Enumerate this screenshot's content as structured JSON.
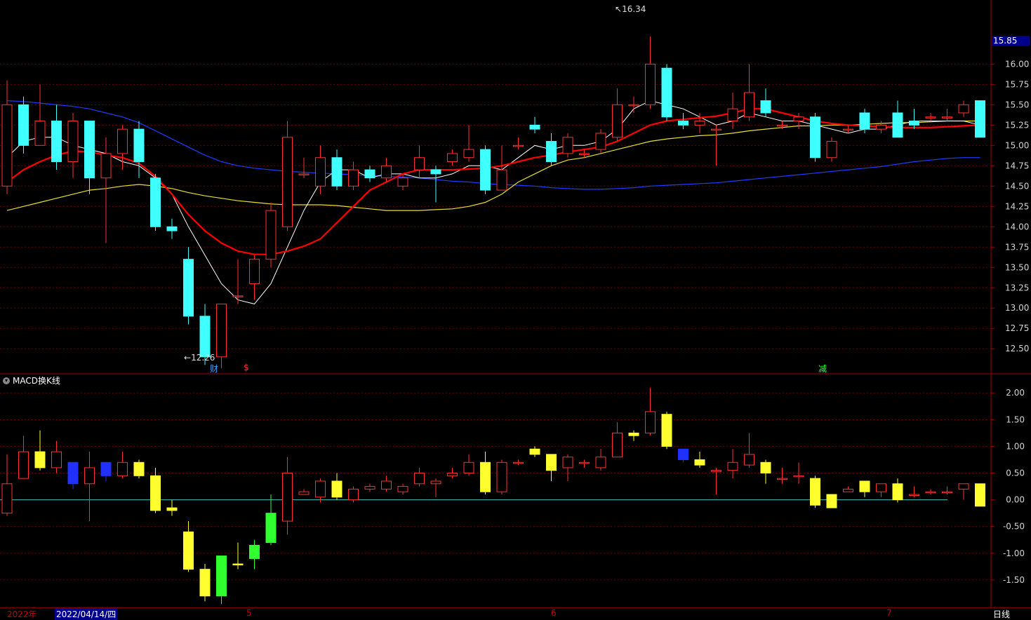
{
  "price_axis_labels": [
    "16.00",
    "15.75",
    "15.50",
    "15.25",
    "15.00",
    "14.75",
    "14.50",
    "14.25",
    "14.00",
    "13.75",
    "13.50",
    "13.25",
    "13.00",
    "12.75",
    "12.50"
  ],
  "macd_axis_labels": [
    "2.00",
    "1.50",
    "1.00",
    "0.50",
    "0.00",
    "-0.50",
    "-1.00",
    "-1.50"
  ],
  "current_price": "15.85",
  "high_label": "16.34",
  "low_label": "12.26",
  "indicator_title": "MACD换K线",
  "markers": {
    "cai": "财",
    "dollar": "$",
    "jian": "减"
  },
  "bottom": {
    "year": "2022年",
    "date": "2022/04/14/四",
    "m5": "5",
    "m6": "6",
    "m7": "7",
    "period": "日线"
  },
  "colors": {
    "up": "#ff3030",
    "down": "#40ffff",
    "ma5": "#ffffff",
    "ma10": "#ff0000",
    "ma20": "#e8e030",
    "ma60": "#1e3cff"
  },
  "chart_data": [
    {
      "type": "candlestick",
      "ylim": [
        12.2,
        16.4
      ],
      "candles": [
        [
          14.5,
          15.5,
          15.8,
          14.4
        ],
        [
          15.5,
          15.0,
          15.6,
          14.9
        ],
        [
          15.0,
          15.3,
          15.75,
          15.0
        ],
        [
          15.3,
          14.8,
          15.5,
          14.7
        ],
        [
          14.8,
          15.3,
          15.4,
          14.6
        ],
        [
          15.3,
          14.6,
          15.3,
          14.4
        ],
        [
          14.6,
          14.9,
          15.1,
          13.8
        ],
        [
          14.9,
          15.2,
          15.25,
          14.7
        ],
        [
          15.2,
          14.8,
          15.3,
          14.6
        ],
        [
          14.6,
          14.0,
          14.65,
          13.95
        ],
        [
          14.0,
          13.95,
          14.1,
          13.85
        ],
        [
          13.6,
          12.9,
          13.75,
          12.8
        ],
        [
          12.9,
          12.4,
          13.05,
          12.3
        ],
        [
          12.4,
          13.05,
          13.05,
          12.26
        ],
        [
          13.15,
          13.15,
          13.6,
          13.05
        ],
        [
          13.3,
          13.6,
          13.65,
          13.1
        ],
        [
          13.6,
          14.2,
          14.3,
          13.5
        ],
        [
          14.0,
          15.1,
          15.3,
          13.95
        ],
        [
          14.65,
          14.65,
          14.85,
          14.6
        ],
        [
          14.5,
          14.85,
          15.0,
          14.4
        ],
        [
          14.85,
          14.5,
          14.95,
          14.45
        ],
        [
          14.5,
          14.7,
          14.8,
          14.45
        ],
        [
          14.7,
          14.6,
          14.75,
          14.55
        ],
        [
          14.6,
          14.75,
          14.85,
          14.55
        ],
        [
          14.5,
          14.6,
          14.65,
          14.45
        ],
        [
          14.7,
          14.85,
          15.0,
          14.6
        ],
        [
          14.7,
          14.65,
          14.75,
          14.3
        ],
        [
          14.8,
          14.9,
          14.95,
          14.75
        ],
        [
          14.85,
          14.95,
          15.25,
          14.8
        ],
        [
          14.95,
          14.45,
          15.0,
          14.4
        ],
        [
          14.45,
          14.7,
          15.0,
          14.45
        ],
        [
          15.0,
          15.0,
          15.1,
          14.95
        ],
        [
          15.25,
          15.2,
          15.35,
          15.15
        ],
        [
          15.05,
          14.8,
          15.15,
          14.75
        ],
        [
          14.9,
          15.1,
          15.15,
          14.85
        ],
        [
          14.9,
          14.9,
          14.95,
          14.85
        ],
        [
          14.95,
          15.15,
          15.2,
          14.9
        ],
        [
          15.1,
          15.5,
          15.7,
          15.05
        ],
        [
          15.5,
          15.5,
          15.6,
          15.4
        ],
        [
          15.5,
          16.0,
          16.34,
          15.45
        ],
        [
          15.95,
          15.35,
          16.0,
          15.3
        ],
        [
          15.3,
          15.25,
          15.4,
          15.2
        ],
        [
          15.25,
          15.3,
          15.4,
          15.15
        ],
        [
          15.2,
          15.2,
          15.25,
          14.75
        ],
        [
          15.3,
          15.45,
          15.65,
          15.2
        ],
        [
          15.35,
          15.65,
          16.0,
          15.3
        ],
        [
          15.55,
          15.4,
          15.7,
          15.35
        ],
        [
          15.25,
          15.25,
          15.3,
          15.2
        ],
        [
          15.3,
          15.35,
          15.4,
          15.2
        ],
        [
          15.35,
          14.85,
          15.4,
          14.8
        ],
        [
          14.85,
          15.05,
          15.1,
          14.8
        ],
        [
          15.2,
          15.2,
          15.25,
          15.15
        ],
        [
          15.4,
          15.2,
          15.45,
          15.15
        ],
        [
          15.2,
          15.25,
          15.3,
          15.15
        ],
        [
          15.4,
          15.1,
          15.55,
          15.1
        ],
        [
          15.3,
          15.25,
          15.45,
          15.2
        ],
        [
          15.35,
          15.35,
          15.4,
          15.3
        ],
        [
          15.35,
          15.35,
          15.45,
          15.3
        ],
        [
          15.4,
          15.5,
          15.55,
          15.35
        ],
        [
          15.55,
          15.1,
          15.55,
          15.1
        ]
      ],
      "ma5": [
        14.85,
        15.05,
        15.1,
        15.1,
        15.0,
        14.95,
        14.9,
        14.8,
        14.75,
        14.6,
        14.4,
        14.0,
        13.65,
        13.3,
        13.1,
        13.05,
        13.3,
        13.75,
        14.2,
        14.55,
        14.7,
        14.7,
        14.6,
        14.65,
        14.65,
        14.6,
        14.6,
        14.65,
        14.75,
        14.75,
        14.7,
        14.85,
        15.0,
        14.95,
        15.0,
        15.0,
        15.05,
        15.2,
        15.45,
        15.55,
        15.5,
        15.45,
        15.35,
        15.25,
        15.3,
        15.4,
        15.35,
        15.3,
        15.3,
        15.25,
        15.2,
        15.15,
        15.2,
        15.2,
        15.25,
        15.3,
        15.3,
        15.3,
        15.3,
        15.25
      ],
      "ma10": [
        14.55,
        14.7,
        14.8,
        14.88,
        14.93,
        14.92,
        14.88,
        14.85,
        14.78,
        14.62,
        14.4,
        14.15,
        13.95,
        13.8,
        13.7,
        13.66,
        13.66,
        13.7,
        13.76,
        13.85,
        14.05,
        14.25,
        14.45,
        14.55,
        14.65,
        14.7,
        14.7,
        14.7,
        14.71,
        14.72,
        14.75,
        14.8,
        14.85,
        14.88,
        14.92,
        14.95,
        14.98,
        15.05,
        15.15,
        15.25,
        15.3,
        15.32,
        15.34,
        15.36,
        15.4,
        15.45,
        15.45,
        15.4,
        15.35,
        15.3,
        15.27,
        15.25,
        15.24,
        15.23,
        15.22,
        15.22,
        15.22,
        15.23,
        15.24,
        15.25
      ],
      "ma20": [
        14.2,
        14.25,
        14.3,
        14.35,
        14.4,
        14.45,
        14.47,
        14.5,
        14.52,
        14.5,
        14.47,
        14.42,
        14.38,
        14.35,
        14.32,
        14.3,
        14.28,
        14.27,
        14.27,
        14.27,
        14.26,
        14.24,
        14.22,
        14.2,
        14.2,
        14.2,
        14.21,
        14.22,
        14.25,
        14.3,
        14.4,
        14.55,
        14.65,
        14.75,
        14.82,
        14.85,
        14.9,
        14.95,
        15.0,
        15.05,
        15.08,
        15.1,
        15.12,
        15.13,
        15.15,
        15.18,
        15.2,
        15.22,
        15.24,
        15.24,
        15.25,
        15.25,
        15.26,
        15.27,
        15.28,
        15.28,
        15.29,
        15.3,
        15.3,
        15.3
      ],
      "ma60": [
        15.55,
        15.54,
        15.52,
        15.5,
        15.48,
        15.45,
        15.4,
        15.35,
        15.28,
        15.18,
        15.08,
        14.98,
        14.88,
        14.8,
        14.75,
        14.72,
        14.7,
        14.68,
        14.67,
        14.66,
        14.65,
        14.64,
        14.63,
        14.62,
        14.61,
        14.6,
        14.58,
        14.56,
        14.55,
        14.53,
        14.52,
        14.51,
        14.5,
        14.48,
        14.47,
        14.46,
        14.46,
        14.47,
        14.48,
        14.5,
        14.51,
        14.52,
        14.53,
        14.54,
        14.56,
        14.58,
        14.6,
        14.62,
        14.64,
        14.66,
        14.68,
        14.7,
        14.72,
        14.74,
        14.77,
        14.8,
        14.82,
        14.84,
        14.85,
        14.85
      ]
    },
    {
      "type": "candlestick",
      "ylim": [
        -2.0,
        2.2
      ],
      "candles": [
        [
          -0.25,
          0.3,
          0.85,
          -0.3
        ],
        [
          0.4,
          0.9,
          1.2,
          0.4
        ],
        [
          0.9,
          0.6,
          1.3,
          0.55
        ],
        [
          0.6,
          0.9,
          1.1,
          0.5
        ],
        [
          0.7,
          0.3,
          0.7,
          0.2
        ],
        [
          0.3,
          0.6,
          0.9,
          -0.4
        ],
        [
          0.7,
          0.45,
          0.7,
          0.35
        ],
        [
          0.45,
          0.7,
          0.9,
          0.4
        ],
        [
          0.7,
          0.45,
          0.75,
          0.4
        ],
        [
          0.45,
          -0.2,
          0.6,
          -0.25
        ],
        [
          -0.15,
          -0.2,
          0.0,
          -0.3
        ],
        [
          -0.6,
          -1.3,
          -0.4,
          -1.35
        ],
        [
          -1.3,
          -1.8,
          -1.2,
          -1.9
        ],
        [
          -1.8,
          -1.05,
          -1.05,
          -1.95
        ],
        [
          -1.2,
          -1.22,
          -0.8,
          -1.3
        ],
        [
          -1.1,
          -0.85,
          -0.75,
          -1.3
        ],
        [
          -0.8,
          -0.25,
          0.1,
          -0.85
        ],
        [
          -0.4,
          0.5,
          0.8,
          -0.65
        ],
        [
          0.1,
          0.15,
          0.2,
          0.1
        ],
        [
          0.05,
          0.35,
          0.4,
          -0.05
        ],
        [
          0.35,
          0.05,
          0.5,
          0.0
        ],
        [
          0.0,
          0.2,
          0.25,
          -0.05
        ],
        [
          0.2,
          0.25,
          0.3,
          0.15
        ],
        [
          0.2,
          0.35,
          0.45,
          0.15
        ],
        [
          0.15,
          0.25,
          0.3,
          0.1
        ],
        [
          0.3,
          0.5,
          0.6,
          0.25
        ],
        [
          0.3,
          0.35,
          0.4,
          0.05
        ],
        [
          0.45,
          0.5,
          0.6,
          0.4
        ],
        [
          0.5,
          0.7,
          0.85,
          0.45
        ],
        [
          0.7,
          0.15,
          0.9,
          0.1
        ],
        [
          0.15,
          0.7,
          0.75,
          0.1
        ],
        [
          0.7,
          0.7,
          0.75,
          0.65
        ],
        [
          0.95,
          0.85,
          1.0,
          0.8
        ],
        [
          0.85,
          0.55,
          0.85,
          0.35
        ],
        [
          0.6,
          0.8,
          0.85,
          0.35
        ],
        [
          0.7,
          0.7,
          0.75,
          0.6
        ],
        [
          0.6,
          0.8,
          0.95,
          0.55
        ],
        [
          0.8,
          1.25,
          1.45,
          0.8
        ],
        [
          1.25,
          1.2,
          1.3,
          1.1
        ],
        [
          1.25,
          1.65,
          2.1,
          1.2
        ],
        [
          1.6,
          1.0,
          1.65,
          0.95
        ],
        [
          0.95,
          0.75,
          0.95,
          0.7
        ],
        [
          0.75,
          0.65,
          0.9,
          0.6
        ],
        [
          0.55,
          0.55,
          0.6,
          0.1
        ],
        [
          0.55,
          0.7,
          0.95,
          0.4
        ],
        [
          0.65,
          0.85,
          1.25,
          0.6
        ],
        [
          0.7,
          0.5,
          0.75,
          0.3
        ],
        [
          0.4,
          0.4,
          0.6,
          0.3
        ],
        [
          0.45,
          0.45,
          0.7,
          0.3
        ],
        [
          0.4,
          -0.1,
          0.45,
          -0.15
        ],
        [
          0.1,
          -0.15,
          0.1,
          -0.15
        ],
        [
          0.15,
          0.2,
          0.25,
          0.15
        ],
        [
          0.35,
          0.15,
          0.35,
          0.05
        ],
        [
          0.15,
          0.3,
          0.3,
          0.05
        ],
        [
          0.3,
          0.0,
          0.4,
          -0.05
        ],
        [
          0.1,
          0.1,
          0.25,
          0.05
        ],
        [
          0.15,
          0.15,
          0.2,
          0.1
        ],
        [
          0.15,
          0.15,
          0.25,
          0.1
        ],
        [
          0.2,
          0.3,
          0.3,
          0.0
        ],
        [
          0.3,
          -0.12,
          0.3,
          -0.12
        ]
      ],
      "zero_line": 0.0
    }
  ]
}
